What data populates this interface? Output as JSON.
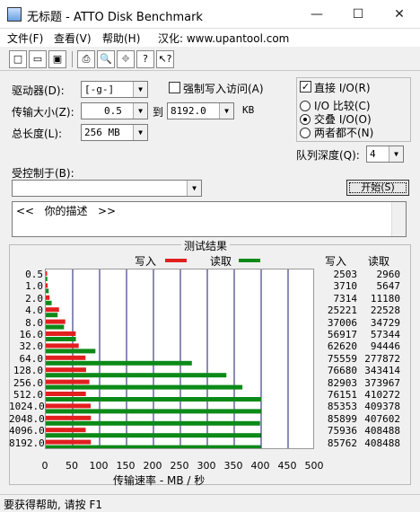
{
  "window": {
    "title": "无标题 - ATTO Disk Benchmark",
    "minimize": "—",
    "maximize": "☐",
    "close": "✕"
  },
  "menu": {
    "file": "文件(F)",
    "view": "查看(V)",
    "help": "帮助(H)",
    "credit": "汉化: www.upantool.com"
  },
  "toolbar": {
    "icons": [
      "new-icon",
      "open-icon",
      "save-icon",
      "print-icon",
      "print-preview-icon",
      "move-icon",
      "help-icon",
      "context-help-icon"
    ]
  },
  "controls": {
    "drive_label": "驱动器(D):",
    "drive_value": "[-g-]",
    "force_write_label": "强制写入访问(A)",
    "force_write_checked": false,
    "transfer_label": "传输大小(Z):",
    "transfer_from": "0.5",
    "transfer_to_label": "到",
    "transfer_to": "8192.0",
    "transfer_unit": "KB",
    "length_label": "总长度(L):",
    "length_value": "256 MB",
    "direct_io_label": "直接 I/O(R)",
    "direct_io_checked": true,
    "radio_compare": "I/O 比较(C)",
    "radio_overlap": "交叠 I/O(O)",
    "radio_neither": "两者都不(N)",
    "selected_radio": "overlap",
    "queue_label": "队列深度(Q):",
    "queue_value": "4",
    "controlled_label": "受控制于(B):",
    "controlled_value": "",
    "start_button": "开始(S)",
    "description": "<<   你的描述   >>"
  },
  "results": {
    "title": "测试结果",
    "legend_write": "写入",
    "legend_read": "读取",
    "col_write": "写入",
    "col_read": "读取",
    "xlabel": "传输速率 - MB / 秒",
    "write_color": "#e21f1f",
    "read_color": "#0c8a18"
  },
  "chart_data": {
    "type": "bar",
    "title": "测试结果",
    "xlabel": "传输速率 - MB / 秒",
    "xlim": [
      0,
      500
    ],
    "xticks": [
      "0",
      "50",
      "100",
      "150",
      "200",
      "250",
      "300",
      "350",
      "400",
      "450",
      "500"
    ],
    "categories": [
      "0.5",
      "1.0",
      "2.0",
      "4.0",
      "8.0",
      "16.0",
      "32.0",
      "64.0",
      "128.0",
      "256.0",
      "512.0",
      "1024.0",
      "2048.0",
      "4096.0",
      "8192.0"
    ],
    "series": [
      {
        "name": "写入",
        "values": [
          2.4,
          3.6,
          7.1,
          24.6,
          36.2,
          55.6,
          61.2,
          73.8,
          74.9,
          81.0,
          74.4,
          83.4,
          83.9,
          74.2,
          83.8
        ]
      },
      {
        "name": "读取",
        "values": [
          2.9,
          5.5,
          10.9,
          22.0,
          33.9,
          56.0,
          92.2,
          271.3,
          335.4,
          365.2,
          400.7,
          399.8,
          398.0,
          399.3,
          399.0
        ]
      }
    ],
    "write_kbs": [
      "2503",
      "3710",
      "7314",
      "25221",
      "37006",
      "56917",
      "62620",
      "75559",
      "76680",
      "82903",
      "76151",
      "85353",
      "85899",
      "75936",
      "85762"
    ],
    "read_kbs": [
      "2960",
      "5647",
      "11180",
      "22528",
      "34729",
      "57344",
      "94446",
      "277872",
      "343414",
      "373967",
      "410272",
      "409378",
      "407602",
      "408488",
      "408488"
    ]
  },
  "status": {
    "text": "要获得帮助, 请按 F1"
  }
}
